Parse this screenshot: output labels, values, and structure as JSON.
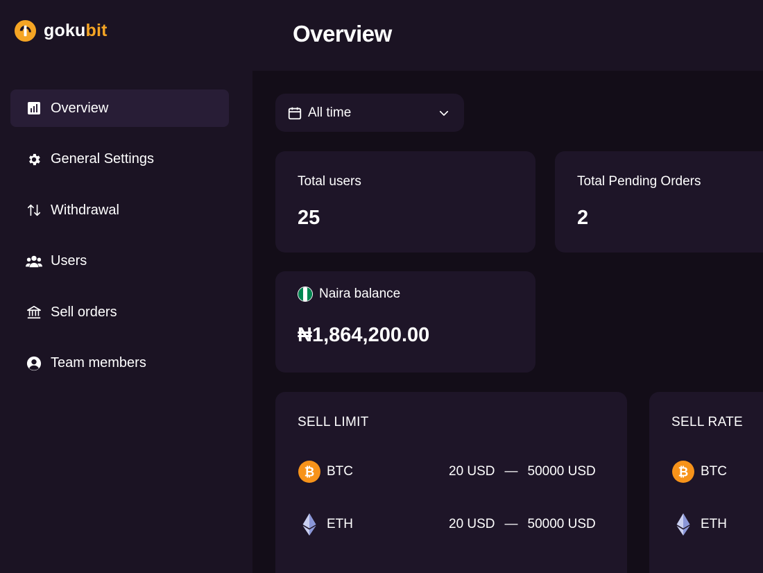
{
  "brand": {
    "name_part1": "goku",
    "name_part2": "bit",
    "accent": "#f5a524"
  },
  "header": {
    "title": "Overview"
  },
  "sidebar": {
    "items": [
      {
        "label": "Overview",
        "icon": "bar-chart-icon",
        "active": true
      },
      {
        "label": "General Settings",
        "icon": "gear-icon"
      },
      {
        "label": "Withdrawal",
        "icon": "swap-arrows-icon"
      },
      {
        "label": "Users",
        "icon": "users-icon"
      },
      {
        "label": "Sell orders",
        "icon": "bank-icon"
      },
      {
        "label": "Team members",
        "icon": "user-circle-icon"
      }
    ]
  },
  "filter": {
    "selected": "All time",
    "icon": "calendar-icon"
  },
  "stats": {
    "total_users": {
      "label": "Total users",
      "value": "25"
    },
    "pending_orders": {
      "label": "Total Pending Orders",
      "value": "2"
    },
    "naira_balance": {
      "label": "Naira balance",
      "value": "₦1,864,200.00",
      "icon": "nigeria-flag-icon"
    }
  },
  "sell_limit": {
    "title": "SELL LIMIT",
    "rows": [
      {
        "coin": "BTC",
        "min": "20 USD",
        "max": "50000 USD",
        "icon": "bitcoin-icon"
      },
      {
        "coin": "ETH",
        "min": "20 USD",
        "max": "50000 USD",
        "icon": "ethereum-icon"
      }
    ]
  },
  "sell_rate": {
    "title": "SELL RATE",
    "rows": [
      {
        "coin": "BTC",
        "icon": "bitcoin-icon"
      },
      {
        "coin": "ETH",
        "icon": "ethereum-icon"
      }
    ]
  },
  "colors": {
    "bg": "#1b1323",
    "main_bg": "#130d18",
    "card": "#1e1528",
    "active_nav": "#281d36",
    "bitcoin": "#f7931a",
    "flag_green": "#008751"
  }
}
